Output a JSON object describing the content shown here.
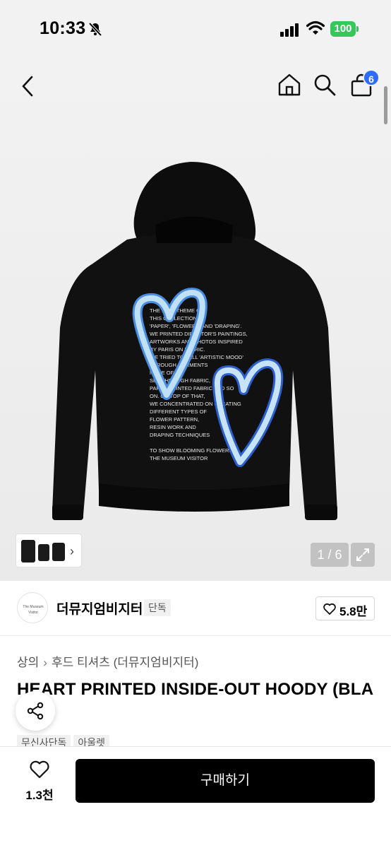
{
  "status_bar": {
    "time": "10:33",
    "battery": "100",
    "battery_color": "#35c759"
  },
  "top_nav": {
    "back_icon": "chevron-left-icon",
    "home_icon": "home-icon",
    "search_icon": "search-icon",
    "cart_icon": "shopping-bag-icon",
    "cart_count": "6",
    "badge_color": "#2f6bff"
  },
  "gallery": {
    "pager": "1 / 6",
    "image_text": "THE MAIN THEME OF THIS COLLECTION IS 'PAPER', 'FLOWERS' AND 'DRAPING'. WE PRINTED DIRECTOR'S PAINTINGS, ARTWORKS AND PHOTOS INSPIRED BY PARIS ON FABRIC. WE TRIED TO TELL 'ARTISTIC MOOD' THROUGH GARMENTS MADE OF SEE THROUGH FABRIC, PAPER PRINTED FABRIC AND SO ON. ON TOP OF THAT, WE CONCENTRATED ON CREATING DIFFERENT TYPES OF FLOWER PATTERN, RESIN WORK AND DRAPING TECHNIQUES TO SHOW BLOOMING FLOWERS TO THE MUSEUM VISITOR",
    "expand_icon": "expand-icon"
  },
  "brand": {
    "logo_text": "The Museum Visitor",
    "name": "더뮤지엄비지터",
    "tag": "단독",
    "likes": "5.8만"
  },
  "breadcrumb": {
    "category": "상의",
    "subcategory": "후드 티셔츠 (더뮤지엄비지터)"
  },
  "product": {
    "title": "HEART PRINTED INSIDE-OUT HOODY (BLA",
    "tags": [
      "무신사단독",
      "아울렛"
    ]
  },
  "bottom_bar": {
    "like_count": "1.3천",
    "buy_label": "구매하기"
  }
}
